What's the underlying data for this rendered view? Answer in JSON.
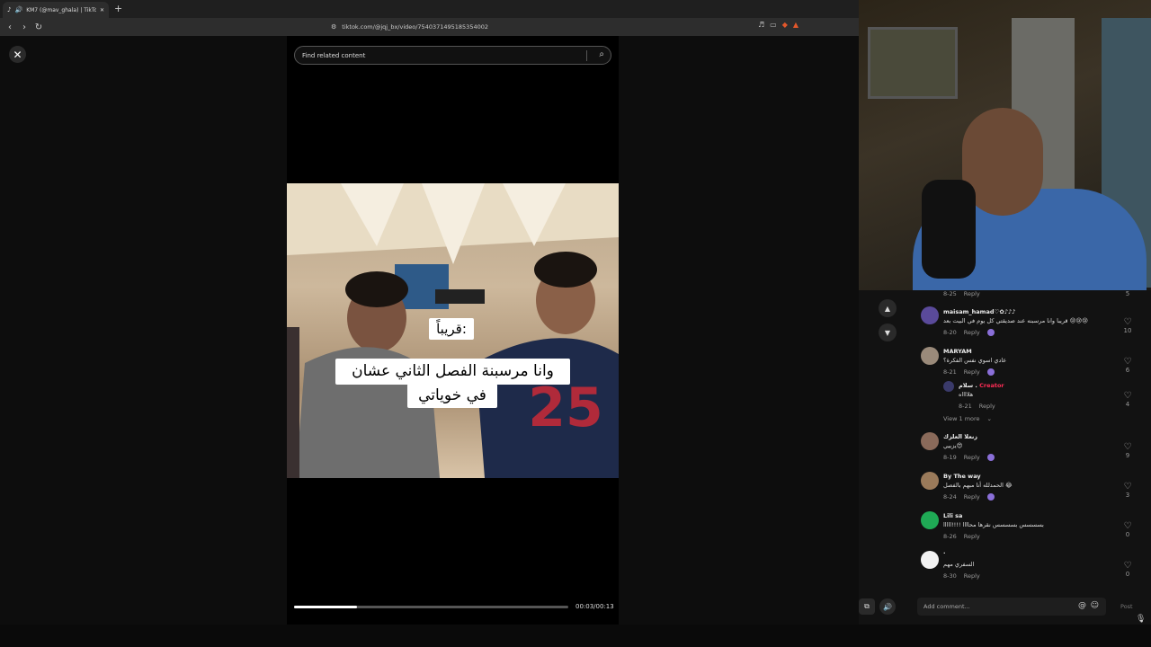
{
  "browser": {
    "tab_title": "KM7 (@mav_ghala) | TikTok",
    "url": "tiktok.com/@jqj_bx/video/7540371495185354002"
  },
  "search": {
    "placeholder": "Find related content"
  },
  "video": {
    "caption_1": "قريباً:",
    "caption_2": "وانا مرسبنة الفصل الثاني عشان",
    "caption_3": "في خوياتي",
    "progress": 0.23,
    "time": "00:03/00:13"
  },
  "comments": {
    "top_meta": {
      "date": "8-25",
      "reply": "Reply",
      "likes": "5"
    },
    "items": [
      {
        "user": "maisam_hamad♡✿♪♪♪",
        "text": "قريبا وانا مرسبنه عند صديقتي كل يوم في البيت بعد 😢😢😢",
        "date": "8-20",
        "reply": "Reply",
        "likes": "10",
        "color": "#5a4a9a"
      },
      {
        "user": "MARYAM",
        "text": "عادي اسوي نفس الفكرة؟",
        "date": "8-21",
        "reply": "Reply",
        "likes": "6",
        "color": "#9a8a7a"
      },
      {
        "user": "سلام. Creator",
        "name_part": "سلام .",
        "creator": "Creator",
        "text": "هلااااه",
        "date": "8-21",
        "reply": "Reply",
        "likes": "4",
        "color": "#3a3a6a"
      },
      {
        "user": "زنعلا العلزك",
        "text": "يزييي😍",
        "date": "8-19",
        "reply": "Reply",
        "likes": "9",
        "color": "#8a6a5a"
      },
      {
        "user": "By The way",
        "text": "الحمدلله أنا مبهم بالفصل 😂",
        "date": "8-24",
        "reply": "Reply",
        "likes": "3",
        "color": "#9a7a5a"
      },
      {
        "user": "Lili sa",
        "text": "بسسسس بسسسس نقرها محاااا !!!!ااااا",
        "date": "8-26",
        "reply": "Reply",
        "likes": "0",
        "color": "#1faa55"
      },
      {
        "user": ".",
        "text": "السفري مهم",
        "date": "8-30",
        "reply": "Reply",
        "likes": "0",
        "color": "#f2f2f2"
      }
    ],
    "view_more": "View 1 more",
    "add_placeholder": "Add comment...",
    "post_label": "Post"
  }
}
